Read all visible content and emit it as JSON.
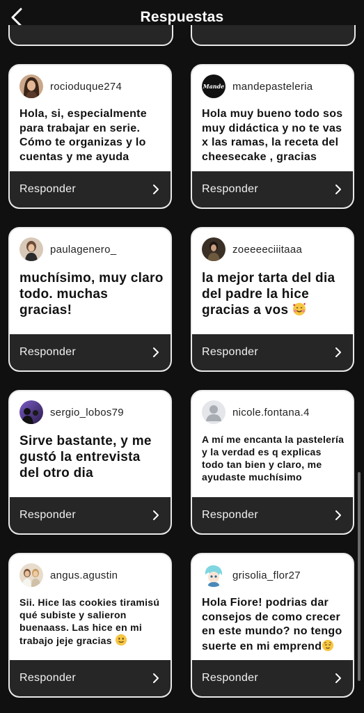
{
  "header": {
    "title": "Respuestas"
  },
  "cards": [
    {
      "username": "rocioduque274",
      "message": "Hola, si, especialmente para trabajar en serie. Cómo te organizas y lo cuentas y me ayuda",
      "reply_label": "Responder"
    },
    {
      "username": "mandepasteleria",
      "avatar_text": "Mande",
      "message": "Hola muy bueno todo sos muy didáctica y no te vas x las ramas, la receta del cheesecake , gracias",
      "reply_label": "Responder"
    },
    {
      "username": "paulagenero_",
      "message": "muchísimo, muy claro todo. muchas gracias!",
      "reply_label": "Responder"
    },
    {
      "username": "zoeeeeciiitaaa",
      "message": "la mejor tarta del dia del padre la hice gracias a vos",
      "reply_label": "Responder"
    },
    {
      "username": "sergio_lobos79",
      "message": "Sirve bastante, y me gustó la entrevista del otro dia",
      "reply_label": "Responder"
    },
    {
      "username": "nicole.fontana.4",
      "message": "A mí me encanta la pastelería y la verdad es q explicas todo tan bien y claro, me ayudaste muchísimo",
      "reply_label": "Responder"
    },
    {
      "username": "angus.agustin",
      "message": "Sii. Hice las cookies tiramisú qué subiste y salieron buenaass. Las hice en mi trabajo jeje gracias",
      "reply_label": "Responder"
    },
    {
      "username": "grisolia_flor27",
      "message": "Hola Fiore! podrias dar consejos de como crecer en este mundo? no tengo suerte en mi emprend",
      "reply_label": "Responder"
    }
  ],
  "icons": {
    "back": "chevron-left-icon",
    "reply": "chevron-right-icon",
    "emoji_hearts": "smiling-face-with-hearts-emoji",
    "emoji_smile": "slightly-smiling-face-emoji",
    "emoji_relieved": "relieved-face-emoji",
    "default_avatar": "default-user-avatar-icon"
  },
  "colors": {
    "background": "#101010",
    "card": "#ffffff",
    "reply_bar": "#262626",
    "text": "#111111"
  }
}
